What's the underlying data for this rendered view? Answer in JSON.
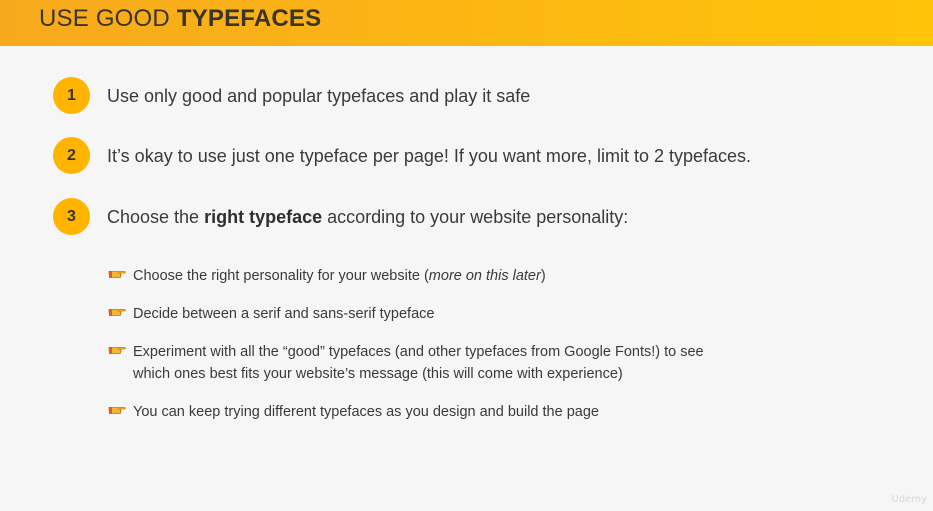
{
  "header": {
    "title_prefix": "USE GOOD ",
    "title_strong": "TYPEFACES"
  },
  "points": [
    {
      "number": "1",
      "text_before": "Use only good and popular typefaces and play it safe",
      "text_strong": "",
      "text_after": ""
    },
    {
      "number": "2",
      "text_before": "It’s okay to use just one typeface per page! If you want more, limit to 2 typefaces.",
      "text_strong": "",
      "text_after": ""
    },
    {
      "number": "3",
      "text_before": "Choose the ",
      "text_strong": "right typeface",
      "text_after": " according to your website personality:"
    }
  ],
  "bullets": [
    {
      "icon": "pointing-hand-icon",
      "line1_before": "Choose the right personality for your website (",
      "line1_em": "more on this later",
      "line1_after": ")",
      "line2": ""
    },
    {
      "icon": "pointing-hand-icon",
      "line1_before": "Decide between a serif and sans-serif typeface",
      "line1_em": "",
      "line1_after": "",
      "line2": ""
    },
    {
      "icon": "pointing-hand-icon",
      "line1_before": "Experiment with all the “good” typefaces (and other typefaces from Google Fonts!) to see",
      "line1_em": "",
      "line1_after": "",
      "line2": "which ones best fits your website’s message (this will come with experience)"
    },
    {
      "icon": "pointing-hand-icon",
      "line1_before": "You can keep trying different typefaces as you design and build the page",
      "line1_em": "",
      "line1_after": "",
      "line2": ""
    }
  ],
  "watermark": "Udemy",
  "colors": {
    "accent": "#ffb400",
    "header_start": "#f7a91d",
    "header_end": "#ffc408",
    "text": "#3a3a3a",
    "background": "#f6f6f6"
  }
}
